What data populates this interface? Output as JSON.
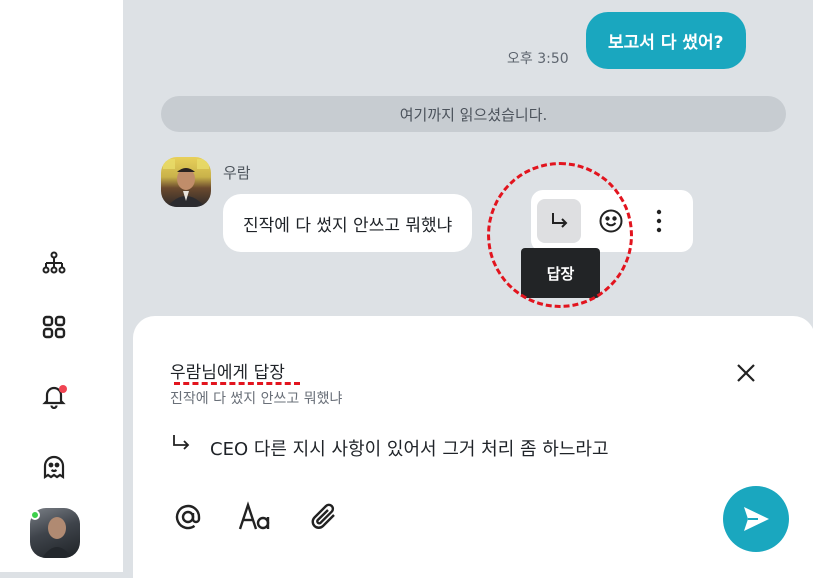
{
  "sidebar": {
    "icons": [
      "org-chart-icon",
      "apps-grid-icon",
      "bell-icon",
      "ghost-icon"
    ],
    "has_notification": true,
    "profile_online": true,
    "colors": {
      "notification_dot": "#f04452",
      "online_dot": "#3ed04c"
    }
  },
  "chat": {
    "outgoing": {
      "text": "보고서 다 썼어?",
      "time": "오후 3:50"
    },
    "read_banner": "여기까지 읽으셨습니다.",
    "incoming": {
      "sender": "우람",
      "text": "진작에 다 썼지 안쓰고 뭐했냐"
    },
    "actions": {
      "reply_icon": "reply-arrow-icon",
      "emoji_icon": "emoji-icon",
      "more_icon": "more-vertical-icon",
      "tooltip": "답장"
    }
  },
  "composer": {
    "reply_title": "우람님에게 답장",
    "reply_quote": "진작에 다 썼지 안쓰고 뭐했냐",
    "draft_text": "CEO 다른 지시 사항이 있어서 그거 처리 좀 하느라고",
    "tools": [
      "mention-icon",
      "text-format-icon",
      "attach-icon"
    ],
    "send_icon": "send-icon"
  },
  "colors": {
    "accent": "#1aa7bf",
    "annotation": "#e2141e",
    "background": "#dde1e5"
  }
}
